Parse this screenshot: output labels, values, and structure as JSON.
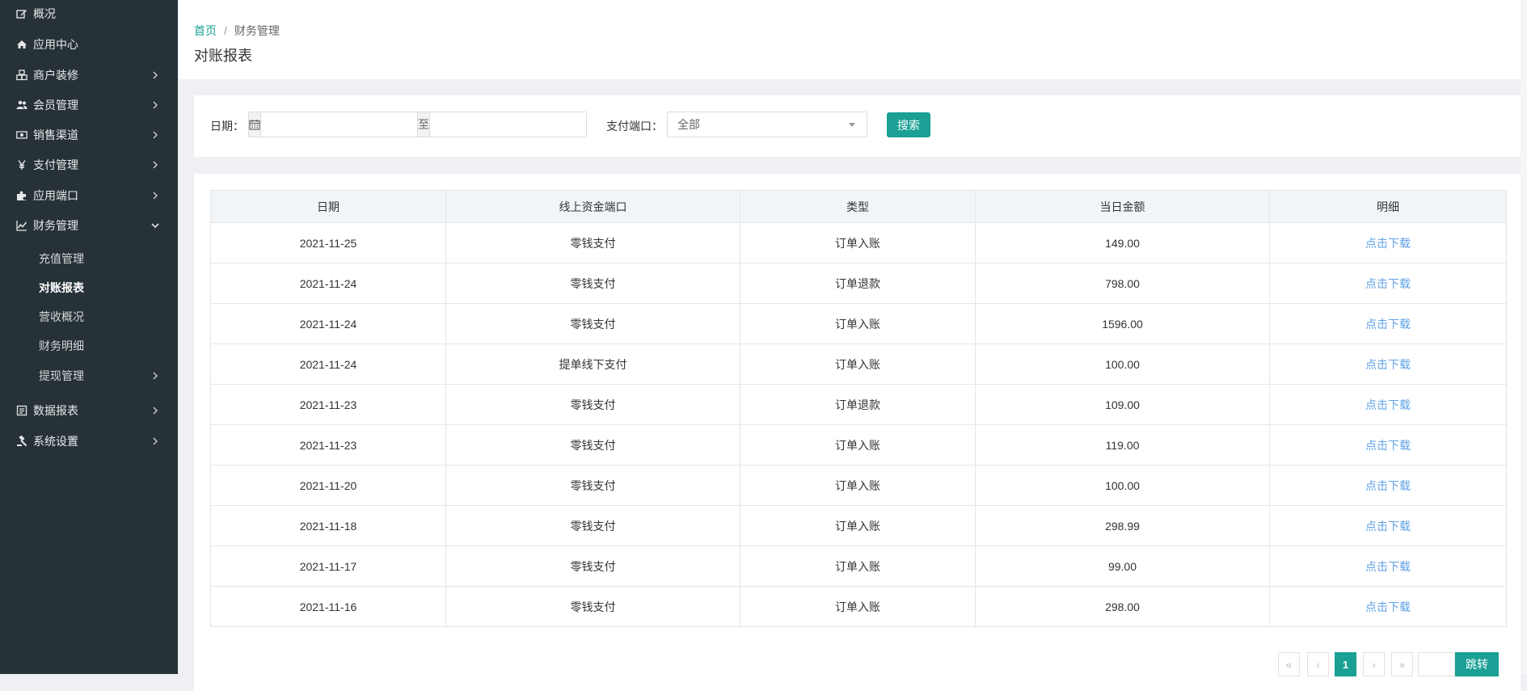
{
  "sidebar": {
    "items": [
      {
        "label": "概况",
        "icon": "edit-icon",
        "has_children": false
      },
      {
        "label": "应用中心",
        "icon": "home-icon",
        "has_children": false
      },
      {
        "label": "商户装修",
        "icon": "cubes-icon",
        "has_children": true
      },
      {
        "label": "会员管理",
        "icon": "users-icon",
        "has_children": true
      },
      {
        "label": "销售渠道",
        "icon": "money-icon",
        "has_children": true
      },
      {
        "label": "支付管理",
        "icon": "yen-icon",
        "has_children": true
      },
      {
        "label": "应用端口",
        "icon": "puzzle-icon",
        "has_children": true
      },
      {
        "label": "财务管理",
        "icon": "line-chart-icon",
        "has_children": true,
        "expanded": true
      },
      {
        "label": "数据报表",
        "icon": "report-icon",
        "has_children": true
      },
      {
        "label": "系统设置",
        "icon": "gavel-icon",
        "has_children": true
      }
    ],
    "sub_items": [
      {
        "label": "充值管理",
        "active": false
      },
      {
        "label": "对账报表",
        "active": true
      },
      {
        "label": "营收概况",
        "active": false
      },
      {
        "label": "财务明细",
        "active": false
      },
      {
        "label": "提现管理",
        "active": false,
        "has_children": true
      }
    ]
  },
  "header": {
    "breadcrumb_home": "首页",
    "breadcrumb_sep": "/",
    "breadcrumb_current": "财务管理",
    "title": "对账报表"
  },
  "search": {
    "date_label": "日期：",
    "date_to": "至",
    "date_start_value": "",
    "date_end_value": "",
    "port_label": "支付端口：",
    "port_selected": "全部",
    "search_button": "搜索"
  },
  "table": {
    "columns": [
      "日期",
      "线上资金端口",
      "类型",
      "当日金额",
      "明细"
    ],
    "rows": [
      [
        "2021-11-25",
        "零钱支付",
        "订单入账",
        "149.00",
        "点击下载"
      ],
      [
        "2021-11-24",
        "零钱支付",
        "订单退款",
        "798.00",
        "点击下载"
      ],
      [
        "2021-11-24",
        "零钱支付",
        "订单入账",
        "1596.00",
        "点击下载"
      ],
      [
        "2021-11-24",
        "提单线下支付",
        "订单入账",
        "100.00",
        "点击下载"
      ],
      [
        "2021-11-23",
        "零钱支付",
        "订单退款",
        "109.00",
        "点击下载"
      ],
      [
        "2021-11-23",
        "零钱支付",
        "订单入账",
        "119.00",
        "点击下载"
      ],
      [
        "2021-11-20",
        "零钱支付",
        "订单入账",
        "100.00",
        "点击下载"
      ],
      [
        "2021-11-18",
        "零钱支付",
        "订单入账",
        "298.99",
        "点击下载"
      ],
      [
        "2021-11-17",
        "零钱支付",
        "订单入账",
        "99.00",
        "点击下载"
      ],
      [
        "2021-11-16",
        "零钱支付",
        "订单入账",
        "298.00",
        "点击下载"
      ]
    ]
  },
  "pagination": {
    "first": "«",
    "prev": "‹",
    "current": "1",
    "next": "›",
    "last": "»",
    "jump_value": "",
    "go_label": "跳转"
  },
  "colors": {
    "sidebar_bg": "#263238",
    "accent": "#1aa094",
    "link": "#5fa1e6"
  }
}
